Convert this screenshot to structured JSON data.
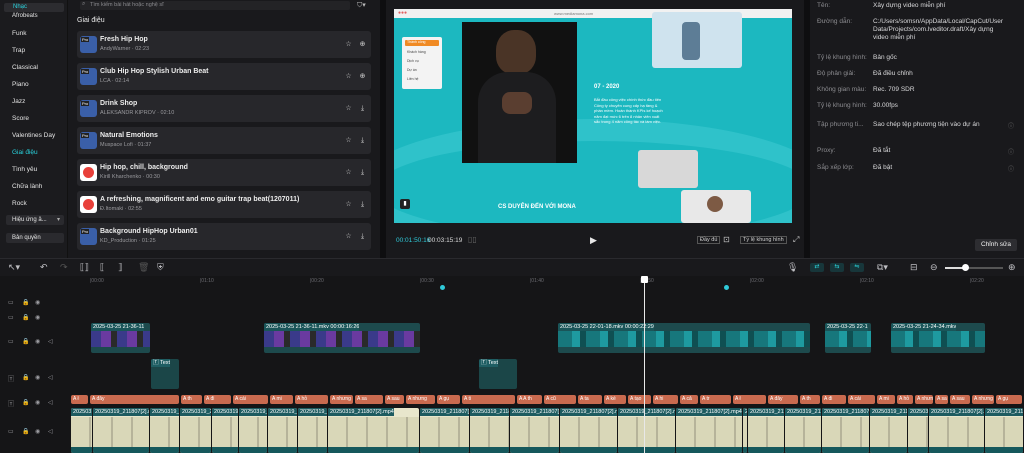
{
  "sidebar": {
    "top": "Nhạc",
    "items": [
      "Afrobeats",
      "Funk",
      "Trap",
      "Classical",
      "Piano",
      "Jazz",
      "Score",
      "Valentines Day",
      "Giai điệu",
      "Tình yêu",
      "Chữa lành",
      "Rock",
      "Hiệu ứng â...",
      "Bản quyền"
    ]
  },
  "music": {
    "search_placeholder": "Tìm kiếm bài hát hoặc nghệ sĩ",
    "section": "Giai điệu",
    "tracks": [
      {
        "title": "Fresh Hip Hop",
        "sub": "AndyWarner · 02:23",
        "color": "#3a5fa8",
        "tag": "Pro"
      },
      {
        "title": "Club Hip Hop Stylish Urban Beat",
        "sub": "LCA · 02:14",
        "color": "#3a5fa8",
        "tag": "Pro"
      },
      {
        "title": "Drink Shop",
        "sub": "ALEKSANDR KIPROV · 02:10",
        "color": "#3a5fa8",
        "tag": "Pro"
      },
      {
        "title": "Natural Emotions",
        "sub": "Muspace Lofi · 01:37",
        "color": "#3a5fa8",
        "tag": "Pro"
      },
      {
        "title": "Hip hop, chill, background",
        "sub": "Kirill Kharchenko · 00:30",
        "color": "#ffffff",
        "tag": ""
      },
      {
        "title": "A refreshing, magnificent and emo guitar trap beat(1207011)",
        "sub": "Đ.Itomaki · 02:55",
        "color": "#ffffff",
        "tag": ""
      },
      {
        "title": "Background HipHop Urban01",
        "sub": "KD_Production · 01:25",
        "color": "#3a5fa8",
        "tag": "Pro"
      }
    ]
  },
  "player": {
    "url": "www.mediamona.com",
    "slide_year": "07 - 2020",
    "slide_text": "Bắt đầu công việc chính thức đầu tiên Công ty chuyên cung cấp hạ tầng & phần mềm. Hoàn thành KPIs kế hoạch năm đạt mức 6 trên 8 nhân viên xuất sắc trong 4 năm công tác và làm việc.",
    "slide_footer": "CS DUYÊN ĐẾN VỚI MONA",
    "menu_items": [
      "Thành công",
      "Khách hàng",
      "Dịch vụ",
      "Dự án",
      "Liên hệ"
    ],
    "current_time": "00:01:50:16",
    "total_time": "00:03:15:19",
    "btn_full": "Đầy đủ",
    "btn_ratio": "Tỷ lệ khung hình"
  },
  "props": {
    "rows": [
      {
        "label": "Tên:",
        "value": "Xây dựng video miễn phí"
      },
      {
        "label": "Đường dẫn:",
        "value": "C:/Users/somsn/AppData/Local/CapCut/User Data/Projects/com.lveditor.draft/Xây dựng video miễn phí"
      },
      {
        "label": "Tỷ lệ khung hình:",
        "value": "Bản gốc"
      },
      {
        "label": "Độ phân giải:",
        "value": "Đã điều chỉnh"
      },
      {
        "label": "Không gian màu:",
        "value": "Rec. 709 SDR"
      },
      {
        "label": "Tỷ lệ khung hình:",
        "value": "30.00fps"
      },
      {
        "label": "Tập phương ti...",
        "value": "Sao chép tệp phương tiện vào dự án"
      },
      {
        "label": "Proxy:",
        "value": "Đã tắt"
      },
      {
        "label": "Sắp xếp lớp:",
        "value": "Đã bật"
      }
    ],
    "edit_button": "Chỉnh sửa"
  },
  "timeline": {
    "ruler": [
      "|00:00",
      "|01:10",
      "|00:20",
      "|00:30",
      "|01:40",
      "|01:50",
      "|02:00",
      "|02:10",
      "|02:20"
    ],
    "video_clips": [
      {
        "label": "2025-03-25 21-36-11",
        "start": 0.089
      },
      {
        "label": "2025-03-25 21-36-11.mkv  00:00:16:26",
        "start": 0.258
      },
      {
        "label": "2025-03-25 22-01-18.mkv  00:00:22:29",
        "start": 0.546
      },
      {
        "label": "2025-03-25 22-1",
        "start": 0.805
      },
      {
        "label": "2025-03-25 21-24-34.mkv",
        "start": 0.871
      }
    ],
    "text_clips": [
      "Text",
      "Text"
    ],
    "caption_words": [
      "A ł",
      "A đây",
      "A th",
      "A đi",
      "A cái",
      "A mi",
      "A hỏ",
      "A nhưng",
      "A sa",
      "A sau",
      "A nhưng",
      "A gụ",
      "A ti",
      "A A th",
      "A cũ",
      "A ta",
      "A ké",
      "A tạo",
      "A hi",
      "A cả",
      "A tr"
    ],
    "main_clip": "20250319_211807[2].mp4",
    "main_clip_long": "20250319_211807[2].mp4  00:00:13:21",
    "main_clip_long2": "20250319_211807[2].mp4  00:00:10:17"
  }
}
